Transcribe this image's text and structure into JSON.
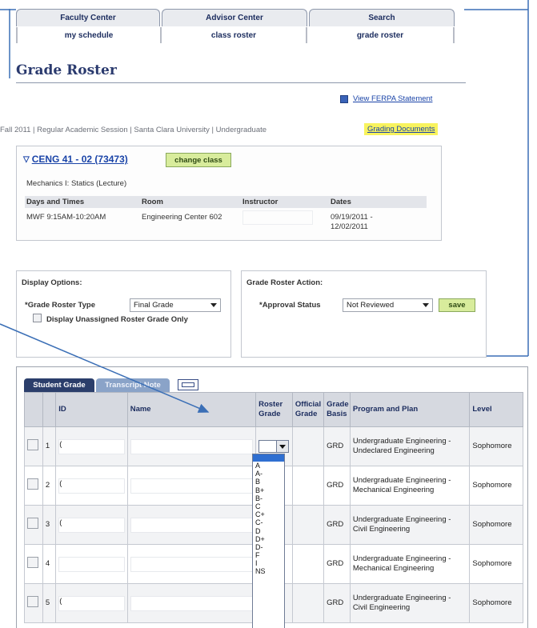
{
  "tabs": {
    "top": [
      "Faculty Center",
      "Advisor Center",
      "Search"
    ],
    "sub": [
      "my schedule",
      "class roster",
      "grade roster"
    ]
  },
  "page_title": "Grade Roster",
  "ferpa_link": "View FERPA Statement",
  "session_line": "Fall 2011 | Regular Academic Session | Santa Clara University | Undergraduate",
  "grading_documents": "Grading Documents",
  "class_info": {
    "class_link": "CENG 41 - 02 (73473)",
    "change_class": "change class",
    "course_name": "Mechanics I: Statics (Lecture)",
    "headers": [
      "Days and Times",
      "Room",
      "Instructor",
      "Dates"
    ],
    "row": {
      "days_times": "MWF 9:15AM-10:20AM",
      "room": "Engineering Center 602",
      "instructor": "",
      "dates": "09/19/2011 -\n12/02/2011"
    }
  },
  "display_options": {
    "title": "Display Options:",
    "roster_type_label": "*Grade Roster Type",
    "roster_type_value": "Final Grade",
    "unassigned_label": "Display Unassigned Roster Grade Only"
  },
  "roster_action": {
    "title": "Grade Roster Action:",
    "approval_label": "*Approval Status",
    "approval_value": "Not Reviewed",
    "save": "save"
  },
  "grid": {
    "tab_active": "Student Grade",
    "tab_inactive": "Transcript Note",
    "columns": [
      "",
      "",
      "ID",
      "Name",
      "Roster Grade",
      "Official Grade",
      "Grade Basis",
      "Program and Plan",
      "Level"
    ],
    "rows": [
      {
        "num": "1",
        "id": "(",
        "basis": "GRD",
        "program": "Undergraduate Engineering - Undeclared Engineering",
        "level": "Sophomore"
      },
      {
        "num": "2",
        "id": "(",
        "basis": "GRD",
        "program": "Undergraduate Engineering - Mechanical Engineering",
        "level": "Sophomore"
      },
      {
        "num": "3",
        "id": "(",
        "basis": "GRD",
        "program": "Undergraduate Engineering - Civil Engineering",
        "level": "Sophomore"
      },
      {
        "num": "4",
        "id": "",
        "basis": "GRD",
        "program": "Undergraduate Engineering - Mechanical Engineering",
        "level": "Sophomore"
      },
      {
        "num": "5",
        "id": "(",
        "basis": "GRD",
        "program": "Undergraduate Engineering - Civil Engineering",
        "level": "Sophomore"
      }
    ]
  },
  "grade_options": [
    "A",
    "A-",
    "B",
    "B+",
    "B-",
    "C",
    "C+",
    "C-",
    "D",
    "D+",
    "D-",
    "F",
    "I",
    "NS"
  ],
  "accent_colors": {
    "button": "#d8ec9c",
    "tab_active": "#2b3e6b",
    "highlight": "#f8f35e",
    "annotation_arrow": "#3b6fb6"
  }
}
